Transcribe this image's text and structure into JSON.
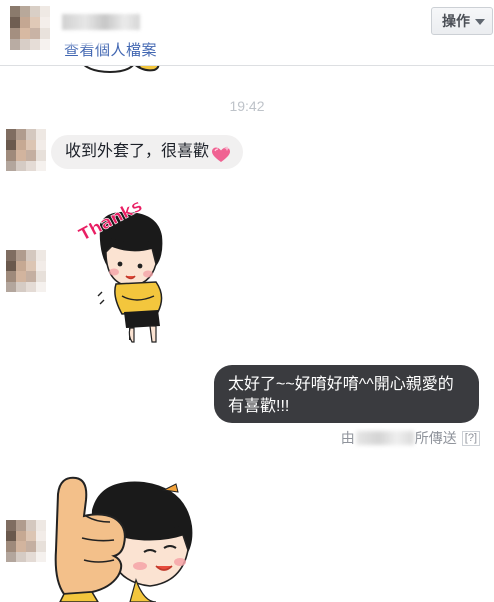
{
  "header": {
    "profile_link": "查看個人檔案",
    "action_label": "操作"
  },
  "icons": {
    "action_caret": "caret-down-icon",
    "heart": "sparkling-heart-icon"
  },
  "conversation": {
    "timestamp": "19:42",
    "incoming_message": "收到外套了，很喜歡",
    "sticker_text": "Thanks",
    "outgoing_message_line1": "太好了~~好唷好唷^^開心親愛的",
    "outgoing_message_line2": "有喜歡!!!",
    "sent_by_prefix": "由",
    "sent_by_suffix": "所傳送",
    "help_mark": "[?]"
  },
  "colors": {
    "link": "#4267b2",
    "incoming_bubble": "#f1f0f0",
    "outgoing_bubble": "#3a3b3f",
    "meta_text": "#90949c"
  }
}
